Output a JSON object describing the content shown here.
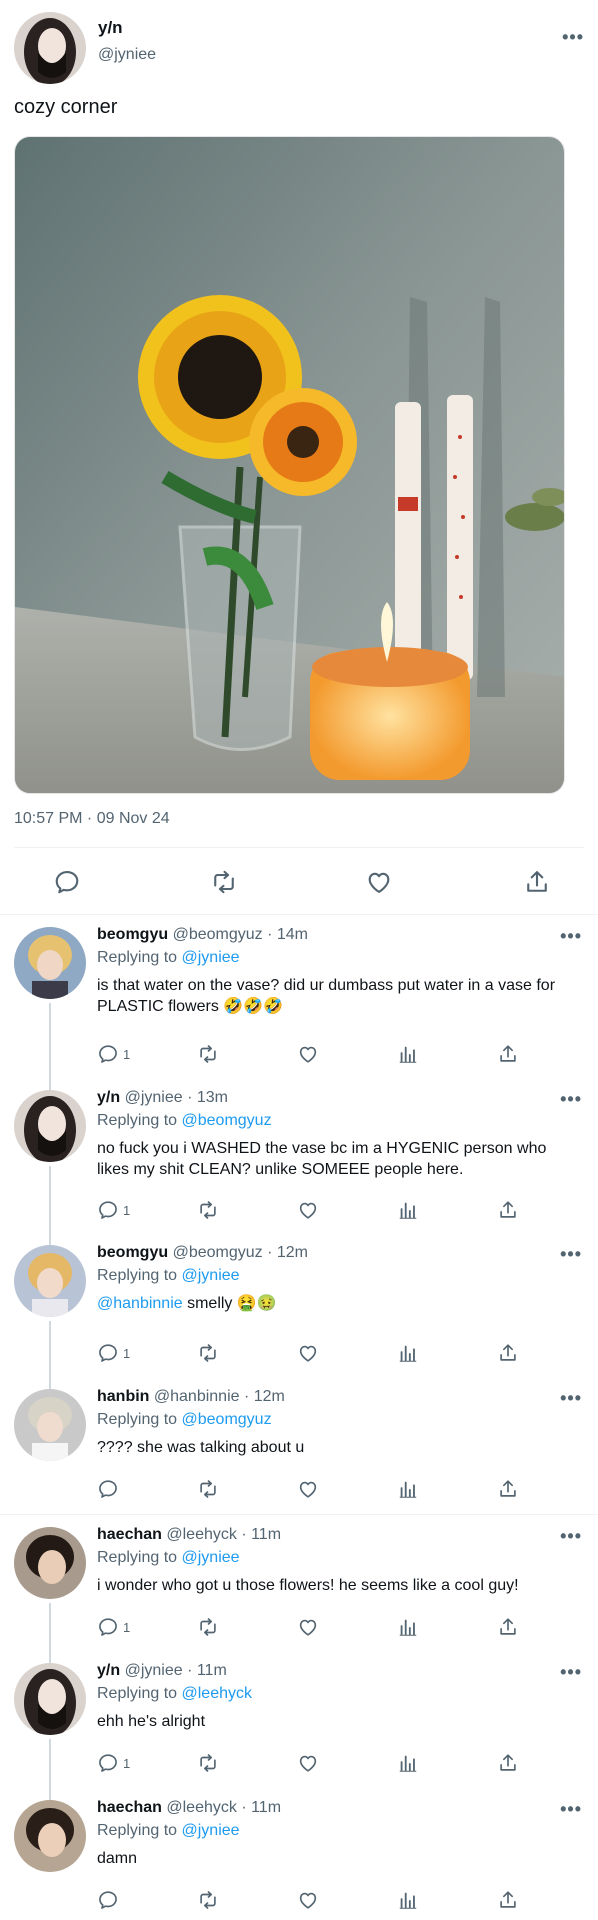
{
  "main_tweet": {
    "name": "y/n",
    "handle": "@jyniee",
    "text": "cozy corner",
    "timestamp": "10:57 PM · 09 Nov 24",
    "more": "•••",
    "photo_icon": "sunflower-candle-photo",
    "actions": [
      "reply-icon",
      "retweet-icon",
      "like-icon",
      "share-icon"
    ]
  },
  "replies": [
    {
      "name": "beomgyu",
      "handle_time": "@beomgyuz · 14m",
      "replying_label": "Replying to",
      "replying_to": "@jyniee",
      "text": "is that water on the vase? did ur dumbass put water in a vase for PLASTIC flowers 🤣🤣🤣",
      "reply_count": "1"
    },
    {
      "name": "y/n",
      "handle_time": "@jyniee · 13m",
      "replying_label": "Replying to",
      "replying_to": "@beomgyuz",
      "text": "no fuck you i WASHED the vase bc im a HYGENIC person who likes my shit CLEAN? unlike SOMEEE people here.",
      "reply_count": "1"
    },
    {
      "name": "beomgyu",
      "handle_time": "@beomgyuz · 12m",
      "replying_label": "Replying to",
      "replying_to": "@jyniee",
      "mention": "@hanbinnie",
      "text": " smelly 🤮🤢",
      "reply_count": "1"
    },
    {
      "name": "hanbin",
      "handle_time": "@hanbinnie · 12m",
      "replying_label": "Replying to",
      "replying_to": "@beomgyuz",
      "text": "???? she was talking about u",
      "reply_count": ""
    },
    {
      "name": "haechan",
      "handle_time": "@leehyck · 11m",
      "replying_label": "Replying to",
      "replying_to": "@jyniee",
      "text": "i wonder who got u those flowers! he seems like a cool guy!",
      "reply_count": "1"
    },
    {
      "name": "y/n",
      "handle_time": "@jyniee · 11m",
      "replying_label": "Replying to",
      "replying_to": "@leehyck",
      "text": "ehh he's alright",
      "reply_count": "1"
    },
    {
      "name": "haechan",
      "handle_time": "@leehyck · 11m",
      "replying_label": "Replying to",
      "replying_to": "@jyniee",
      "text": "damn",
      "reply_count": ""
    }
  ],
  "colors": {
    "link": "#1d9bf0",
    "muted": "#536471",
    "text": "#0f1419",
    "divider": "#eff3f4"
  }
}
